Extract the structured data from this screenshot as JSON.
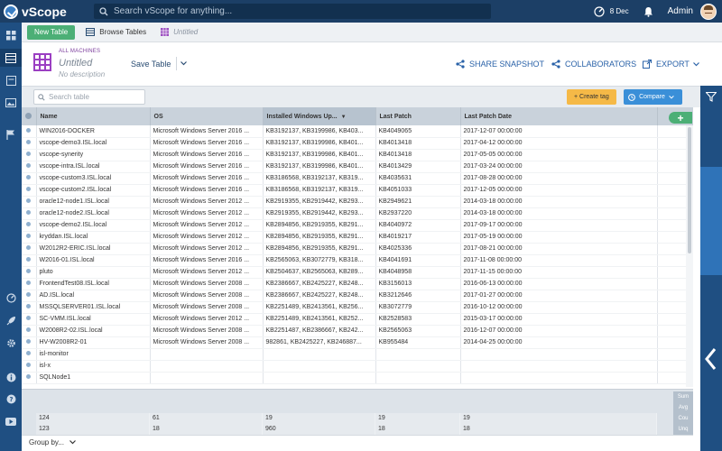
{
  "app": {
    "name": "vScope"
  },
  "topbar": {
    "search_placeholder": "Search vScope for anything...",
    "date": "8 Dec",
    "user": "Admin"
  },
  "tabs": {
    "new_table": "New Table",
    "browse_tables": "Browse Tables",
    "untitled": "Untitled"
  },
  "header": {
    "kicker": "ALL MACHINES",
    "title": "Untitled",
    "description": "No description",
    "save": "Save Table",
    "share": "SHARE SNAPSHOT",
    "collaborators": "COLLABORATORS",
    "export": "EXPORT"
  },
  "filter": {
    "search_placeholder": "Search table",
    "create_tag": "+ Create tag",
    "compare": "Compare"
  },
  "table": {
    "columns": [
      "Name",
      "OS",
      "Installed Windows Up...",
      "Last Patch",
      "Last Patch Date"
    ],
    "rows": [
      [
        "WIN2016-DOCKER",
        "Microsoft Windows Server 2016 ...",
        "KB3192137, KB3199986, KB403...",
        "KB4049065",
        "2017-12-07 00:00:00"
      ],
      [
        "vscope-demo3.ISL.local",
        "Microsoft Windows Server 2016 ...",
        "KB3192137, KB3199986, KB401...",
        "KB4013418",
        "2017-04-12 00:00:00"
      ],
      [
        "vscope-synerity",
        "Microsoft Windows Server 2016 ...",
        "KB3192137, KB3199986, KB401...",
        "KB4013418",
        "2017-05-05 00:00:00"
      ],
      [
        "vscope-intra.ISL.local",
        "Microsoft Windows Server 2016 ...",
        "KB3192137, KB3199986, KB401...",
        "KB4013429",
        "2017-03-24 00:00:00"
      ],
      [
        "vscope-custom3.ISL.local",
        "Microsoft Windows Server 2016 ...",
        "KB3186568, KB3192137, KB319...",
        "KB4035631",
        "2017-08-28 00:00:00"
      ],
      [
        "vscope-custom2.ISL.local",
        "Microsoft Windows Server 2016 ...",
        "KB3186568, KB3192137, KB319...",
        "KB4051033",
        "2017-12-05 00:00:00"
      ],
      [
        "oracle12-node1.ISL.local",
        "Microsoft Windows Server 2012 ...",
        "KB2919355, KB2919442, KB293...",
        "KB2949621",
        "2014-03-18 00:00:00"
      ],
      [
        "oracle12-node2.ISL.local",
        "Microsoft Windows Server 2012 ...",
        "KB2919355, KB2919442, KB293...",
        "KB2937220",
        "2014-03-18 00:00:00"
      ],
      [
        "vscope-demo2.ISL.local",
        "Microsoft Windows Server 2012 ...",
        "KB2894856, KB2919355, KB291...",
        "KB4040972",
        "2017-09-17 00:00:00"
      ],
      [
        "kryddan.ISL.local",
        "Microsoft Windows Server 2012 ...",
        "KB2894856, KB2919355, KB291...",
        "KB4019217",
        "2017-05-19 00:00:00"
      ],
      [
        "W2012R2-ERIC.ISL.local",
        "Microsoft Windows Server 2012 ...",
        "KB2894856, KB2919355, KB291...",
        "KB4025336",
        "2017-08-21 00:00:00"
      ],
      [
        "W2016-01.ISL.local",
        "Microsoft Windows Server 2016 ...",
        "KB2565063, KB3072779, KB318...",
        "KB4041691",
        "2017-11-08 00:00:00"
      ],
      [
        "pluto",
        "Microsoft Windows Server 2012 ...",
        "KB2504637, KB2565063, KB289...",
        "KB4048958",
        "2017-11-15 00:00:00"
      ],
      [
        "FrontendTest08.ISL.local",
        "Microsoft Windows Server 2008 ...",
        "KB2386667, KB2425227, KB248...",
        "KB3156013",
        "2016-06-13 00:00:00"
      ],
      [
        "AD.ISL.local",
        "Microsoft Windows Server 2008 ...",
        "KB2386667, KB2425227, KB248...",
        "KB3212646",
        "2017-01-27 00:00:00"
      ],
      [
        "MSSQLSERVER01.ISL.local",
        "Microsoft Windows Server 2008 ...",
        "KB2251489, KB2413561, KB256...",
        "KB3072779",
        "2016-10-12 00:00:00"
      ],
      [
        "SC-VMM.ISL.local",
        "Microsoft Windows Server 2012 ...",
        "KB2251489, KB2413561, KB252...",
        "KB2528583",
        "2015-03-17 00:00:00"
      ],
      [
        "W2008R2-02.ISL.local",
        "Microsoft Windows Server 2008 ...",
        "KB2251487, KB2386667, KB242...",
        "KB2565063",
        "2016-12-07 00:00:00"
      ],
      [
        "HV-W2008R2-01",
        "Microsoft Windows Server 2008 ...",
        "982861, KB2425227, KB246887...",
        "KB955484",
        "2014-04-25 00:00:00"
      ],
      [
        "isl-monitor",
        "",
        "",
        "",
        ""
      ],
      [
        "isl-x",
        "",
        "",
        "",
        ""
      ],
      [
        "SQLNode1",
        "",
        "",
        "",
        ""
      ]
    ]
  },
  "aggregates": {
    "labels": [
      "Sum",
      "Avg",
      "Cou",
      "Unq"
    ],
    "count": [
      "124",
      "61",
      "19",
      "19",
      "19"
    ],
    "unique": [
      "123",
      "18",
      "960",
      "18",
      "18"
    ]
  },
  "footer": {
    "group_by": "Group by..."
  },
  "colors": {
    "topbar": "#1c3f66",
    "sidebar": "#1f4f82",
    "accent_green": "#4caf76",
    "accent_orange": "#f5b947",
    "accent_blue": "#3a8fd8",
    "purple": "#7b3c9c"
  },
  "icons": [
    "search-icon",
    "bell-icon",
    "filter-icon",
    "plus-icon",
    "chevron-left-icon",
    "share-icon",
    "collaborators-icon",
    "export-icon"
  ]
}
